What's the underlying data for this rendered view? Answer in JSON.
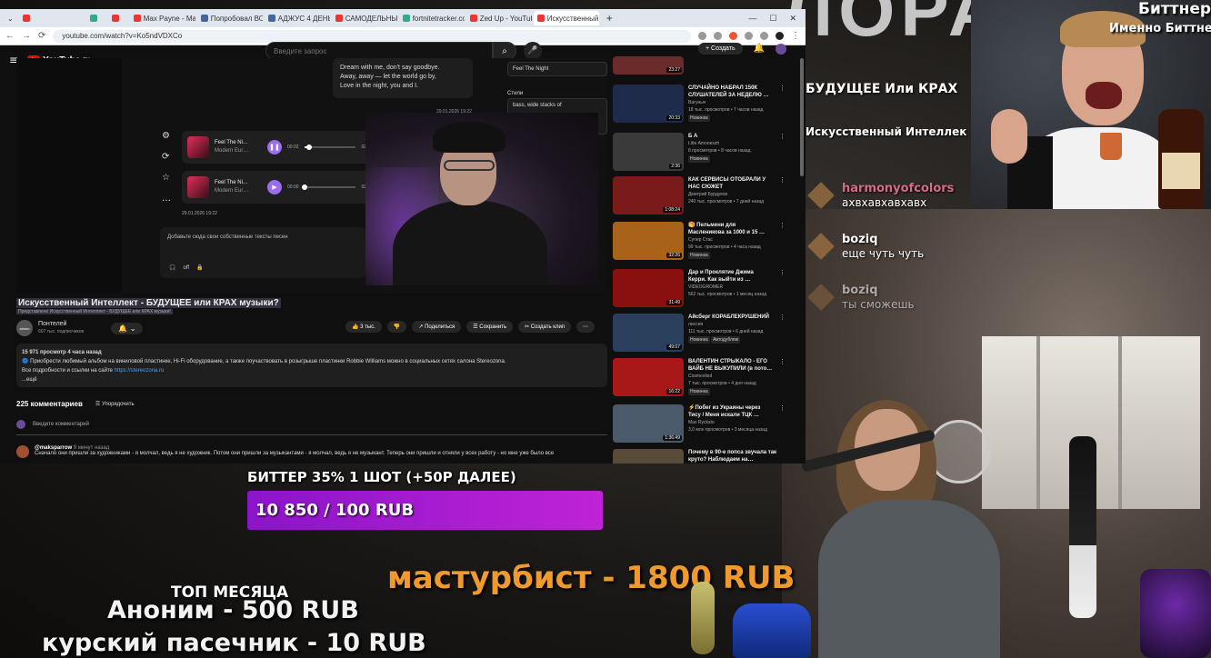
{
  "browser": {
    "tabs": [
      {
        "label": "",
        "active": false
      },
      {
        "label": "",
        "active": false
      },
      {
        "label": "",
        "active": false
      },
      {
        "label": "Max Payne - Main T",
        "active": false
      },
      {
        "label": "Попробовал ВОО…",
        "active": false
      },
      {
        "label": "АДЖУС 4 ДЕНЬ 7 2…",
        "active": false
      },
      {
        "label": "САМОДЕЛЬНЫЙ Д…",
        "active": false
      },
      {
        "label": "fortnitetracker.com",
        "active": false
      },
      {
        "label": "Zed Up - YouTube",
        "active": false
      },
      {
        "label": "Искусственный Интел…",
        "active": true
      }
    ],
    "add_tab": "+",
    "url": "youtube.com/watch?v=Ko5ndVDXCo"
  },
  "youtube": {
    "logo": "YouTube",
    "region": "RU",
    "search_placeholder": "Введите запрос",
    "create_label": "+ Создать",
    "lyrics_line1": "Dream with me, don't say goodbye.",
    "lyrics_line2": "Away, away — let the world go by,",
    "lyrics_line3": "Love in the night, you and I.",
    "lyrics_time": "29.01.2026 19:22",
    "sidebox_title": "Feel The Night",
    "sidebox_label": "Стили",
    "sidebox_text": "bass, wide stacks of",
    "tracks": [
      {
        "title": "Feel The Ni…",
        "artist": "Modern Eur…",
        "start": "00:02",
        "end": "02:57",
        "progress": 0.1
      },
      {
        "title": "Feel The Ni…",
        "artist": "Modern Eur…",
        "start": "00:00",
        "end": "02:43",
        "progress": 0.0
      }
    ],
    "track_date": "29.01.2026 19:22",
    "text_panel_placeholder": "Добавьте сюда свои собственные тексты песен",
    "text_panel_toggle": "off",
    "video_title": "Искусственный Интеллект - БУДУЩЕЕ или КРАХ музыки?",
    "video_subtitle": "Представлено Искусственный Интеллект - БУДУЩЕЕ или КРАХ музыки!",
    "channel_name": "Понтелей",
    "channel_subs": "607 тыс. подписчиков",
    "channel_avatar_text": "ainmo",
    "likes": "3 тыс.",
    "share": "Поделиться",
    "save": "Сохранить",
    "clip": "Создать клип",
    "desc_stats": "15 971 просмотр  4 часа назад",
    "desc_line1": "🔵 Приобрести любимый альбом на виниловой пластинке, Hi-Fi оборудование, а также поучаствовать в розыгрыше пластинки Robbie Williams можно в социальных сетях салона Stereozona.",
    "desc_line2_text": "Все подробности и ссылки на сайте",
    "desc_link": "https://stereozona.ru",
    "desc_more": "...ещё",
    "comments_count": "225 комментариев",
    "sort_label": "Упорядочить",
    "add_comment_placeholder": "Введите комментарий",
    "comment_author": "@maksparrow",
    "comment_ago": "9 минут назад",
    "comment_text": "Сначало они пришли за художниками - я молчал, ведь я не художник. Потом они пришли за музыкантами - я молчал, ведь я не музыкант. Теперь они пришли и отняли у всех работу - но мне уже было все"
  },
  "recommendations": [
    {
      "title": "",
      "channel": "",
      "meta": "",
      "badge": "",
      "duration": "23:27",
      "color": "#6a2b2b"
    },
    {
      "title": "СЛУЧАЙНО НАБРАЛ 150К СЛУШАТЕЛЕЙ ЗА НЕДЕЛЮ …",
      "channel": "Вагуныч",
      "meta": "18 тыс. просмотров • 7 часов назад",
      "badge": "Новинка",
      "duration": "20:33",
      "color": "#1f2b4a"
    },
    {
      "title": "Б А",
      "channel": "Litte Amoneszh",
      "meta": "8 просмотров • 8 часов назад",
      "badge": "Новинка",
      "duration": "2:36",
      "color": "#3a3a3a"
    },
    {
      "title": "КАК СЕРВИСЫ ОТОБРАЛИ У НАС СЮЖЕТ",
      "channel": "Дмитрий Бурдуков",
      "meta": "240 тыс. просмотров • 7 дней назад",
      "badge": "",
      "duration": "1:08:24",
      "color": "#7a1a1a"
    },
    {
      "title": "🥞 Пельмени для Масленикова за 1000 и 15 …",
      "channel": "Супер Стас",
      "meta": "99 тыс. просмотров • 4 часа назад",
      "badge": "Новинка",
      "duration": "32:26",
      "color": "#a8621a"
    },
    {
      "title": "Дар и Проклятие Джима Керри. Как выйти из …",
      "channel": "VIDEOGROMER",
      "meta": "562 тыс. просмотров • 1 месяц назад",
      "badge": "",
      "duration": "31:49",
      "color": "#8a1010"
    },
    {
      "title": "Айсберг КОРАБЛЕКРУШЕНИЙ",
      "channel": "лиссия",
      "meta": "111 тыс. просмотров • 6 дней назад",
      "badge": "Новинка",
      "badge2": "Автодубляж",
      "duration": "49:07",
      "color": "#2a3f5c"
    },
    {
      "title": "ВАЛЕНТИН СТРЫКАЛО - ЕГО ВАЙБ НЕ ВЫКУПИЛИ (в пото…",
      "channel": "Cosmoviled",
      "meta": "7 тыс. просмотров • 4 дня назад",
      "badge": "Новинка",
      "duration": "16:22",
      "color": "#a81818"
    },
    {
      "title": "⚡Побег из Украины через Тису / Меня искали ТЦК …",
      "channel": "Max Rycksto",
      "meta": "3,0 млн просмотров • 3 месяца назад",
      "badge": "",
      "duration": "1:36:49",
      "color": "#4a5a6a"
    },
    {
      "title": "Почему в 90-е попса звучала так круто? Наблюдаем на…",
      "channel": "",
      "meta": "",
      "badge": "",
      "duration": "",
      "color": "#5a4a3a"
    }
  ],
  "overlay": {
    "goal_title": "БИТТЕР 35% 1 ШОТ (+50Р ДАЛЕЕ)",
    "goal_progress": "10 850 / 100 RUB",
    "last_donation": "мастурбист - 1800 RUB",
    "top_title": "ТОП МЕСЯЦА",
    "top_donors": [
      "Аноним - 500 RUB",
      "курский пасечник - 10 RUB"
    ],
    "bitter_caption1": "Биттнер!",
    "bitter_caption2": "Именно Биттнер",
    "stream_title1": "БУДУЩЕЕ Или КРАХ",
    "stream_title2": "Искусственный Интеллек"
  },
  "chat": [
    {
      "name": "harmonyofcolors",
      "text": "ахвхавхавхавх",
      "pink": true
    },
    {
      "name": "boziq",
      "text": "еще чуть чуть",
      "pink": false
    },
    {
      "name": "boziq",
      "text": "ты сможешь",
      "pink": false
    }
  ],
  "colors": {
    "goal_bar": "#a81bd0",
    "donation_orange": "#f09a2e",
    "yt_dark": "#0f0f0f"
  }
}
